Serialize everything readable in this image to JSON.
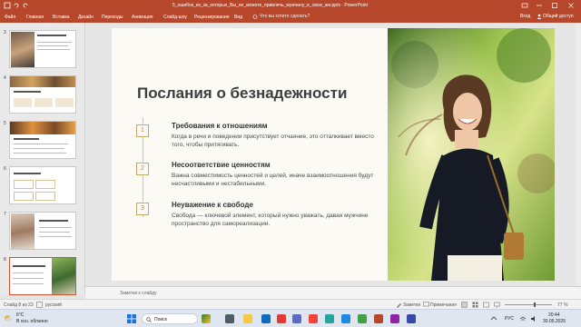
{
  "window": {
    "title": "5_ошибок_из_за_которых_Вы_не_можете_привлечь_мужчину_в_свою_жи.pptx - PowerPoint"
  },
  "ribbon": {
    "tabs": [
      "Файл",
      "Главная",
      "Вставка",
      "Дизайн",
      "Переходы",
      "Анимация",
      "Слайд-шоу",
      "Рецензирование",
      "Вид"
    ],
    "search": "Что вы хотите сделать?",
    "signin": "Вход",
    "share": "Общий доступ"
  },
  "thumbnails": [
    {
      "num": "3",
      "caption": "Ожидание будущего"
    },
    {
      "num": "4",
      "caption": "Проблемы с самооценкой"
    },
    {
      "num": "5",
      "caption": "Привязка к прошлому"
    },
    {
      "num": "6",
      "caption": "Ограничения и контроль"
    },
    {
      "num": "7",
      "caption": "Завышенные ожидания"
    },
    {
      "num": "8",
      "caption": "Послания о безнадежности"
    }
  ],
  "slide": {
    "title": "Послания о безнадежности",
    "items": [
      {
        "num": "1",
        "heading": "Требования к отношениям",
        "body": "Когда в речи и поведении присутствует отчаяние, это отталкивает вместо того, чтобы притягивать."
      },
      {
        "num": "2",
        "heading": "Несоответствие ценностям",
        "body": "Важна совместимость ценностей и целей, иначе взаимоотношения будут несчастливыми и нестабильными."
      },
      {
        "num": "3",
        "heading": "Неуважение к свободе",
        "body": "Свобода — ключевой элемент, который нужно уважать, давая мужчине пространство для самореализации."
      }
    ]
  },
  "notes": {
    "placeholder": "Заметки к слайду"
  },
  "status": {
    "slide": "Слайд 8 из 23",
    "language": "русский",
    "notes_btn": "Заметки",
    "comments_btn": "Примечания",
    "zoom": "77 %"
  },
  "taskbar": {
    "weather_temp": "6°C",
    "weather_desc": "В осн. облачно",
    "search": "Поиск",
    "lang": "РУС",
    "time": "20:44",
    "date": "30.05.2025"
  },
  "colors": {
    "accent": "#b7472a",
    "bullet": "#c9a66b"
  }
}
